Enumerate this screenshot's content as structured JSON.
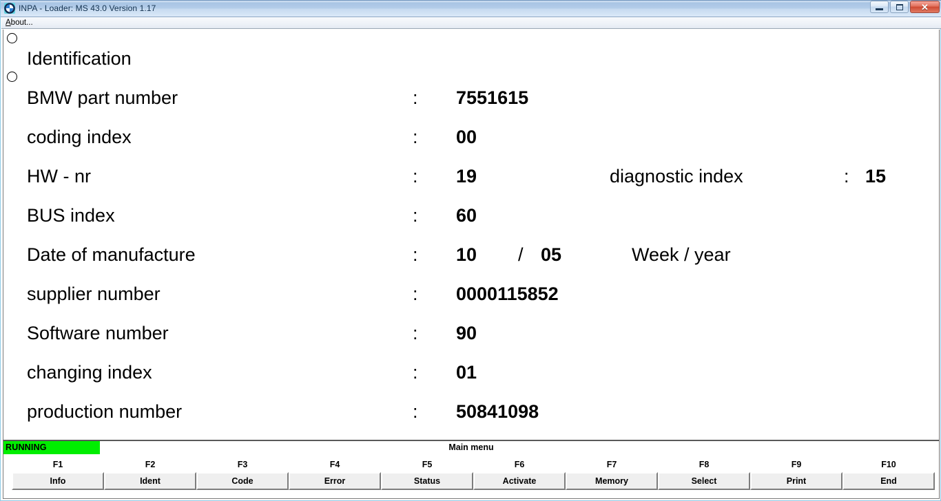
{
  "window": {
    "title": "INPA - Loader:  MS 43.0 Version 1.17",
    "icon": "bmw-roundel-icon",
    "controls": {
      "minimize": "–",
      "maximize": "□",
      "close": "✕"
    }
  },
  "menubar": {
    "items": [
      {
        "accel": "A",
        "rest": "bout..."
      }
    ]
  },
  "screen": {
    "heading": "Identification",
    "rows": [
      {
        "label": "BMW part number",
        "colon": ":",
        "value": "7551615"
      },
      {
        "label": "coding index",
        "colon": ":",
        "value": "00"
      },
      {
        "label": "HW - nr",
        "colon": ":",
        "value": "19",
        "label2": "diagnostic index",
        "colon2": ":",
        "value3": "15"
      },
      {
        "label": "BUS index",
        "colon": ":",
        "value": "60"
      },
      {
        "label": "Date of manufacture",
        "colon": ":",
        "value": "10",
        "sep": "/",
        "value2": "05",
        "note": "Week / year"
      },
      {
        "label": "supplier number",
        "colon": ":",
        "value": "0000115852"
      },
      {
        "label": "Software number",
        "colon": ":",
        "value": "90"
      },
      {
        "label": "changing index",
        "colon": ":",
        "value": "01"
      },
      {
        "label": "production number",
        "colon": ":",
        "value": "50841098"
      }
    ]
  },
  "statusbar": {
    "running_label": "RUNNING",
    "running_color": "#00ee00",
    "menu_title": "Main menu"
  },
  "function_keys": [
    {
      "key": "F1",
      "label": "Info"
    },
    {
      "key": "F2",
      "label": "Ident"
    },
    {
      "key": "F3",
      "label": "Code"
    },
    {
      "key": "F4",
      "label": "Error"
    },
    {
      "key": "F5",
      "label": "Status"
    },
    {
      "key": "F6",
      "label": "Activate"
    },
    {
      "key": "F7",
      "label": "Memory"
    },
    {
      "key": "F8",
      "label": "Select"
    },
    {
      "key": "F9",
      "label": "Print"
    },
    {
      "key": "F10",
      "label": "End"
    }
  ]
}
